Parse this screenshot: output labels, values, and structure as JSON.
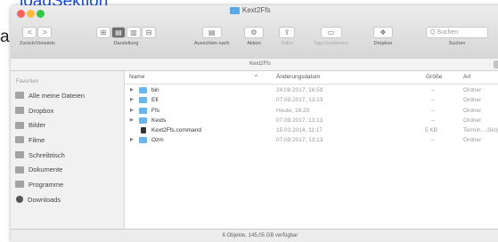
{
  "page": {
    "link_text": "loadSektion",
    "stray_letter": "a"
  },
  "window": {
    "title": "Kext2Ffs",
    "toolbar": {
      "back_label": "<",
      "forward_label": ">",
      "nav_caption": "Zurück/Vorwärts",
      "view_caption": "Darstellung",
      "view_icons": [
        "⊞",
        "▤",
        "▥",
        "⊟"
      ],
      "arrange_caption": "Ausrichten nach",
      "action_caption": "Aktion",
      "share_caption": "Teilen",
      "tags_caption": "Tags bearbeiten",
      "dropbox_caption": "Dropbox",
      "search_caption": "Suchen",
      "search_placeholder": "Q Suchen"
    },
    "path_label": "Kext2Ffs",
    "add_tab_label": "+",
    "sidebar": {
      "header": "Favoriten",
      "items": [
        {
          "label": "Alle meine Dateien",
          "icon": "all-files-icon"
        },
        {
          "label": "Dropbox",
          "icon": "dropbox-folder-icon"
        },
        {
          "label": "Bilder",
          "icon": "pictures-icon"
        },
        {
          "label": "Filme",
          "icon": "movies-icon"
        },
        {
          "label": "Schreibtisch",
          "icon": "desktop-icon"
        },
        {
          "label": "Dokumente",
          "icon": "documents-icon"
        },
        {
          "label": "Programme",
          "icon": "applications-icon"
        },
        {
          "label": "Downloads",
          "icon": "downloads-icon"
        }
      ]
    },
    "columns": {
      "name": "Name",
      "sort_indicator": "^",
      "date": "Änderungsdatum",
      "size": "Größe",
      "kind": "Art"
    },
    "files": [
      {
        "name": "bin",
        "date": "24.08.2017, 16:59",
        "size": "--",
        "kind": "Ordner",
        "folder": true
      },
      {
        "name": "Efi",
        "date": "07.09.2017, 13:13",
        "size": "--",
        "kind": "Ordner",
        "folder": true
      },
      {
        "name": "Ffs",
        "date": "Heute, 16:20",
        "size": "--",
        "kind": "Ordner",
        "folder": true
      },
      {
        "name": "Kexts",
        "date": "07.09.2017, 13:13",
        "size": "--",
        "kind": "Ordner",
        "folder": true
      },
      {
        "name": "Kext2Ffs.command",
        "date": "15.03.2014, 11:17",
        "size": "5 KB",
        "kind": "Termin...-Skript",
        "folder": false
      },
      {
        "name": "Ozm",
        "date": "07.09.2017, 13:13",
        "size": "--",
        "kind": "Ordner",
        "folder": true
      }
    ],
    "status": "6 Objekte, 145,05 GB verfügbar",
    "colors": {
      "folder": "#6cb4ec",
      "close": "#fc605c",
      "minimize": "#fdbc40",
      "maximize": "#34c84a",
      "link": "#1a4fd6"
    }
  }
}
